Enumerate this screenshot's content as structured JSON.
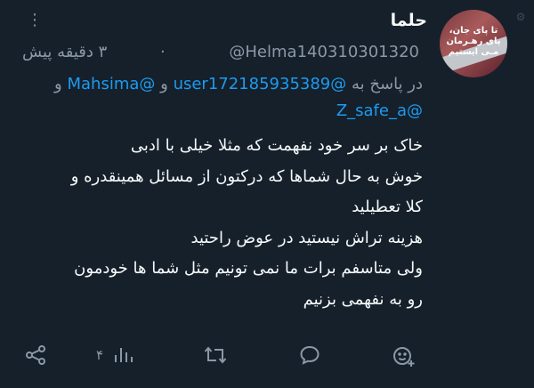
{
  "author": {
    "display_name": "حلما",
    "handle": "@Helma140310301320",
    "time_ago": "۳ دقیقه پیش",
    "avatar_text": "تا پای جان، پای رهـرمان مـی ایستیم"
  },
  "reply_to": {
    "prefix": "در پاسخ به",
    "mention_1": "@user172185935389",
    "joiner_1": "و",
    "mention_2": "@Mahsima",
    "joiner_2": "و",
    "mention_3": "@Z_safe_a"
  },
  "tweet": {
    "lines": [
      "خاک بر سر خود نفهمت که مثلا خیلی با ادبی",
      "خوش به حال شماها که درکتون از مسائل همینقدره و",
      "کلا تعطیلید",
      "هزینه تراش نیستید در عوض راحتید",
      "ولی متاسفم برات ما نمی تونیم مثل شما ها خودمون",
      "رو به نفهمی بزنیم"
    ]
  },
  "actions": {
    "views_count": "۴",
    "more_label": "⋮"
  },
  "colors": {
    "background": "#15202b",
    "text": "#f7f9f9",
    "muted": "#8b98a5",
    "accent": "#1d9bf0"
  },
  "icons": [
    "share-icon",
    "views-icon",
    "retweet-icon",
    "reply-icon",
    "emoji-react-icon",
    "more-icon"
  ]
}
